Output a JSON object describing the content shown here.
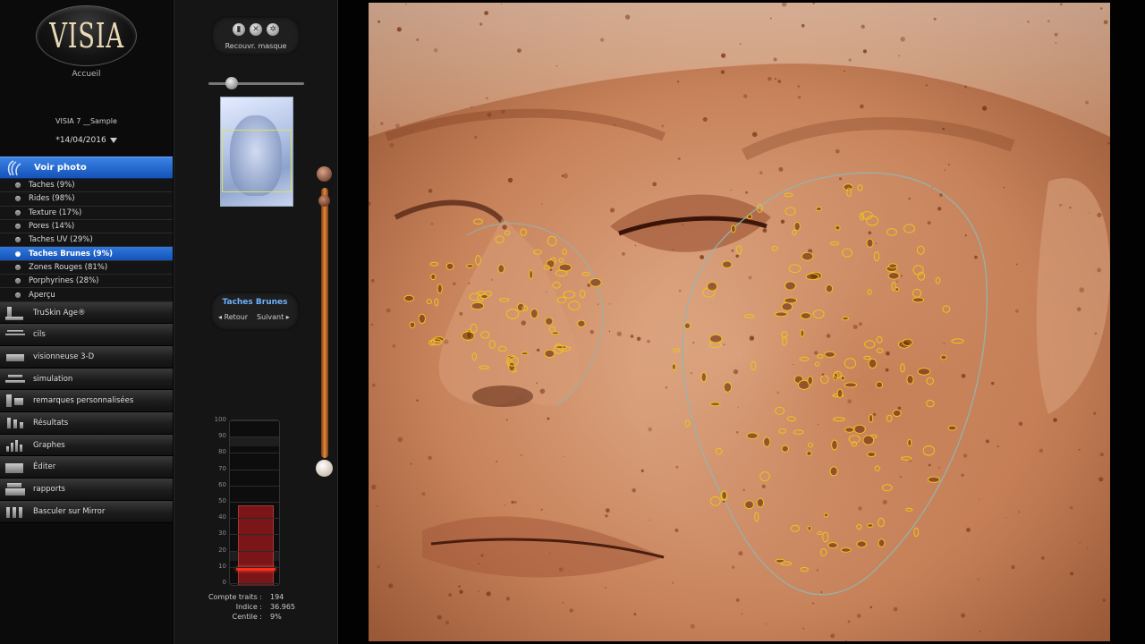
{
  "app": {
    "logo_text": "VISIA",
    "home_label": "Accueil",
    "patient_name": "VISIA 7 __Sample",
    "session_date": "*14/04/2016"
  },
  "sidebar": {
    "section_title": "Voir photo",
    "sub_items": [
      {
        "label": "Taches (9%)",
        "active": false
      },
      {
        "label": "Rides (98%)",
        "active": false
      },
      {
        "label": "Texture (17%)",
        "active": false
      },
      {
        "label": "Pores (14%)",
        "active": false
      },
      {
        "label": "Taches UV (29%)",
        "active": false
      },
      {
        "label": "Taches Brunes (9%)",
        "active": true
      },
      {
        "label": "Zones Rouges (81%)",
        "active": false
      },
      {
        "label": "Porphyrines (28%)",
        "active": false
      },
      {
        "label": "Aperçu",
        "active": false
      }
    ],
    "items": [
      {
        "label": "TruSkin Age®",
        "icon": "truskin-icon"
      },
      {
        "label": "cils",
        "icon": "eyelash-icon"
      },
      {
        "label": "visionneuse 3-D",
        "icon": "viewer-3d-icon"
      },
      {
        "label": "simulation",
        "icon": "simulation-icon"
      },
      {
        "label": "remarques personnalisées",
        "icon": "notes-icon"
      },
      {
        "label": "Résultats",
        "icon": "results-icon"
      },
      {
        "label": "Graphes",
        "icon": "graphs-icon"
      },
      {
        "label": "Éditer",
        "icon": "edit-icon"
      },
      {
        "label": "rapports",
        "icon": "print-icon"
      },
      {
        "label": "Basculer sur Mirror",
        "icon": "mirror-icon"
      }
    ]
  },
  "panel": {
    "mask_label": "Recouvr. masque",
    "navigator": {
      "title": "Taches Brunes",
      "back_label": "Retour",
      "next_label": "Suivant"
    },
    "gauge": {
      "ticks": [
        "100",
        "90",
        "80",
        "70",
        "60",
        "50",
        "40",
        "30",
        "20",
        "10",
        "0"
      ],
      "bar_value": 49,
      "marker_value": 9
    },
    "stats": [
      {
        "label": "Compte traits :",
        "value": "194"
      },
      {
        "label": "Indice :",
        "value": "36.965"
      },
      {
        "label": "Centile :",
        "value": "9%"
      }
    ]
  },
  "colors": {
    "accent_blue": "#1d63cc",
    "skin_sepia": "#c7825a",
    "spot_outline": "#f2c218",
    "gauge_red": "#7a1518"
  }
}
